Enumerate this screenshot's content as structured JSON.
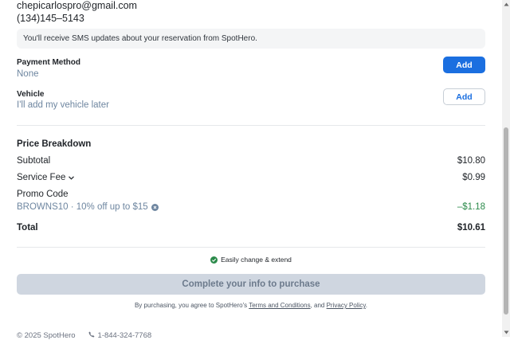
{
  "contact": {
    "email": "chepicarlospro@gmail.com",
    "phone": "(134)145–5143"
  },
  "sms_note": "You'll receive SMS updates about your reservation from SpotHero.",
  "payment": {
    "label": "Payment Method",
    "value": "None",
    "button_label": "Add"
  },
  "vehicle": {
    "label": "Vehicle",
    "value": "I'll add my vehicle later",
    "button_label": "Add"
  },
  "price_breakdown": {
    "title": "Price Breakdown",
    "subtotal_label": "Subtotal",
    "subtotal_value": "$10.80",
    "service_fee_label": "Service Fee",
    "service_fee_value": "$0.99",
    "promo_label": "Promo Code",
    "promo_detail": "BROWNS10 · 10% off up to $15",
    "promo_value": "–$1.18",
    "total_label": "Total",
    "total_value": "$10.61"
  },
  "easy_change": "Easily change & extend",
  "cta_label": "Complete your info to purchase",
  "legal": {
    "prefix": "By purchasing, you agree to SpotHero's ",
    "terms_link": "Terms and Conditions",
    "middle": ", and ",
    "privacy_link": "Privacy Policy",
    "suffix": "."
  },
  "footer": {
    "copyright": "© 2025 SpotHero",
    "phone": "1-844-324-7768"
  },
  "colors": {
    "primary": "#1b6fe0",
    "muted_blue": "#6e86a0",
    "success": "#2b8a4a",
    "disabled_bg": "#cfd6e0"
  },
  "icons": {
    "service_fee_chevron": "chevron-down-icon",
    "promo_info": "info-icon",
    "easy_change": "check-circle-icon",
    "footer_phone": "phone-icon"
  }
}
